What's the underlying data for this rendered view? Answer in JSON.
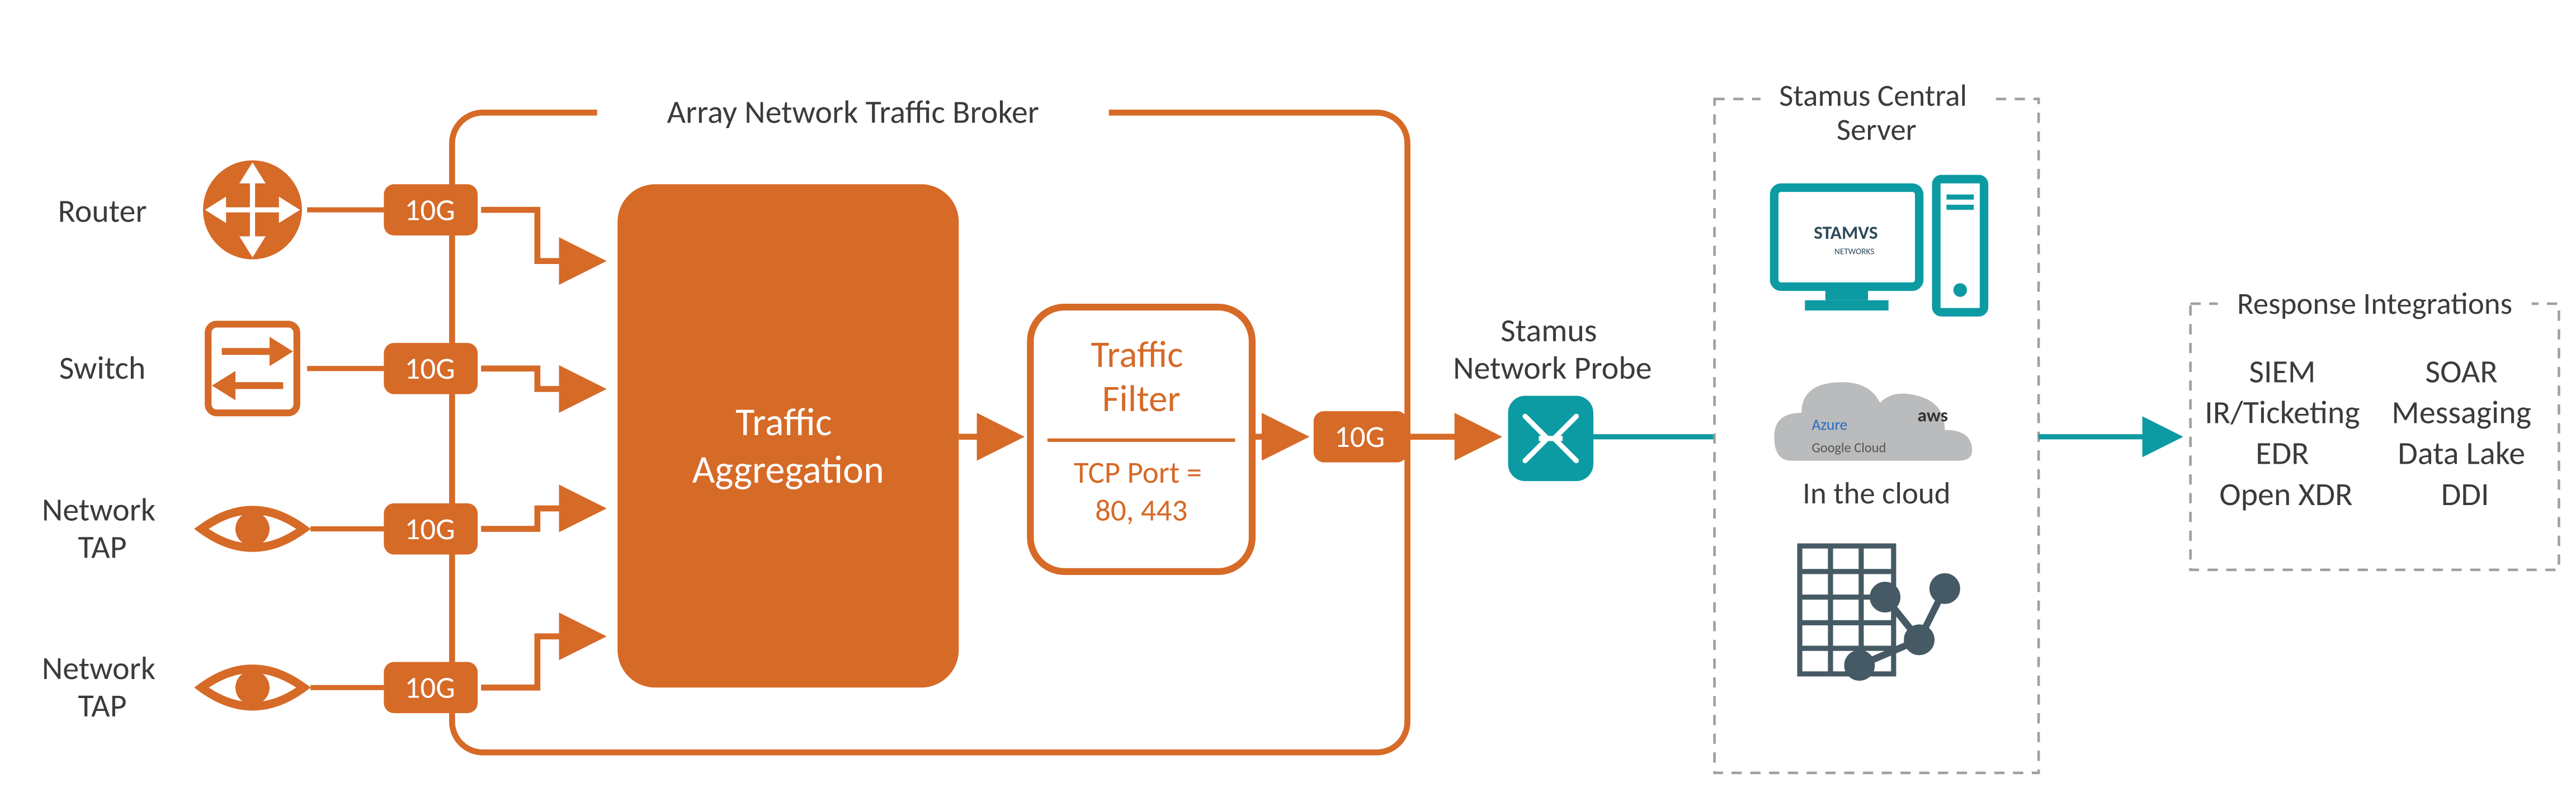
{
  "sources": {
    "router": "Router",
    "switch": "Switch",
    "tap1": "Network\nTAP",
    "tap2": "Network\nTAP"
  },
  "broker": {
    "title": "Array Network Traffic Broker",
    "port_speed": "10G",
    "aggregation": "Traffic\nAggregation",
    "filter_title": "Traffic\nFilter",
    "filter_rule": "TCP Port =\n80, 443",
    "output_speed": "10G"
  },
  "probe": {
    "title": "Stamus\nNetwork Probe"
  },
  "central": {
    "title": "Stamus Central\nServer",
    "stamus_text": "STAMVS",
    "stamus_sub": "NETWORKS",
    "cloud_aws": "aws",
    "cloud_azure": "Azure",
    "cloud_gcp": "Google Cloud",
    "cloud_caption": "In the cloud"
  },
  "response": {
    "title": "Response Integrations",
    "col1": [
      "SIEM",
      "IR/Ticketing",
      "EDR",
      "Open XDR"
    ],
    "col2": [
      "SOAR",
      "Messaging",
      "Data Lake",
      "DDI"
    ]
  },
  "colors": {
    "orange": "#d66a27",
    "teal": "#0d9ba3",
    "grey": "#a0a0a0",
    "dark_text": "#3b3b3b",
    "slate": "#455a64"
  }
}
